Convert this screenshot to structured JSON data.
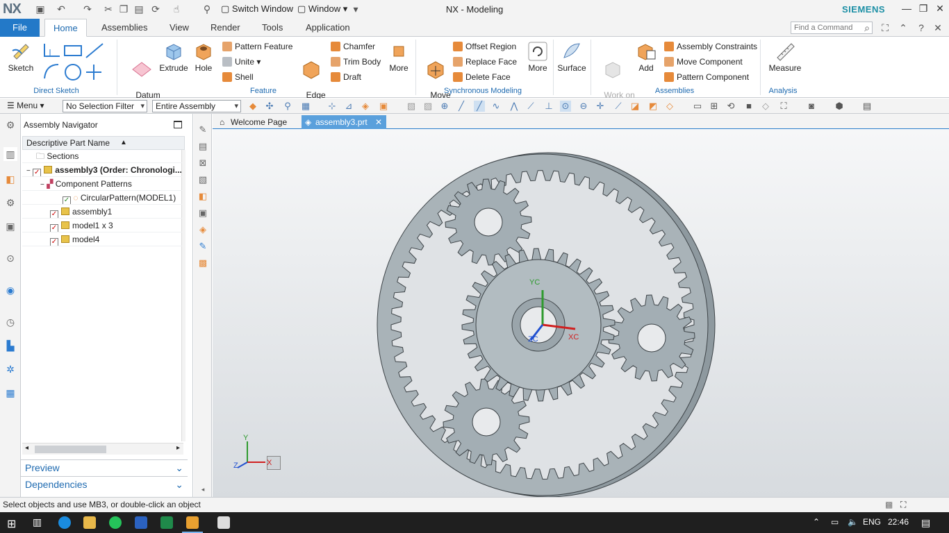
{
  "app": {
    "logo": "NX",
    "title": "NX - Modeling",
    "brand": "SIEMENS"
  },
  "quick_access": {
    "switch_window": "Switch Window",
    "window": "Window"
  },
  "tabs": [
    "File",
    "Home",
    "Assemblies",
    "View",
    "Render",
    "Tools",
    "Application"
  ],
  "find_placeholder": "Find a Command",
  "ribbon": {
    "sketch": "Sketch",
    "direct_sketch": "Direct Sketch",
    "datum_plane": "Datum\nPlane",
    "extrude": "Extrude",
    "hole": "Hole",
    "pattern_feature": "Pattern Feature",
    "unite": "Unite",
    "shell": "Shell",
    "feature": "Feature",
    "edge_blend": "Edge\nBlend",
    "chamfer": "Chamfer",
    "trim_body": "Trim Body",
    "draft": "Draft",
    "more": "More",
    "move_face": "Move\nFace",
    "offset_region": "Offset Region",
    "replace_face": "Replace Face",
    "delete_face": "Delete Face",
    "more2": "More",
    "synchronous_modeling": "Synchronous Modeling",
    "surface": "Surface",
    "work_on_assembly": "Work on\nAssembly",
    "add": "Add",
    "assembly_constraints": "Assembly Constraints",
    "move_component": "Move Component",
    "pattern_component": "Pattern Component",
    "assemblies": "Assemblies",
    "measure": "Measure",
    "analysis": "Analysis"
  },
  "cmdbar": {
    "menu": "Menu",
    "filter": "No Selection Filter",
    "scope": "Entire Assembly"
  },
  "navigator": {
    "title": "Assembly Navigator",
    "column": "Descriptive Part Name",
    "rows": [
      {
        "label": "Sections"
      },
      {
        "label": "assembly3 (Order: Chronologi..."
      },
      {
        "label": "Component Patterns"
      },
      {
        "label": "CircularPattern(MODEL1)"
      },
      {
        "label": "assembly1"
      },
      {
        "label": "model1 x 3"
      },
      {
        "label": "model4"
      }
    ],
    "preview": "Preview",
    "dependencies": "Dependencies"
  },
  "graphics_tabs": {
    "welcome": "Welcome Page",
    "assembly": "assembly3.prt"
  },
  "csys": {
    "yc": "YC",
    "xc": "XC",
    "zc": "ZC",
    "x": "X",
    "y": "Y",
    "z": "Z"
  },
  "status": "Select objects and use MB3, or double-click an object",
  "taskbar": {
    "lang": "ENG",
    "time": "22:46"
  }
}
